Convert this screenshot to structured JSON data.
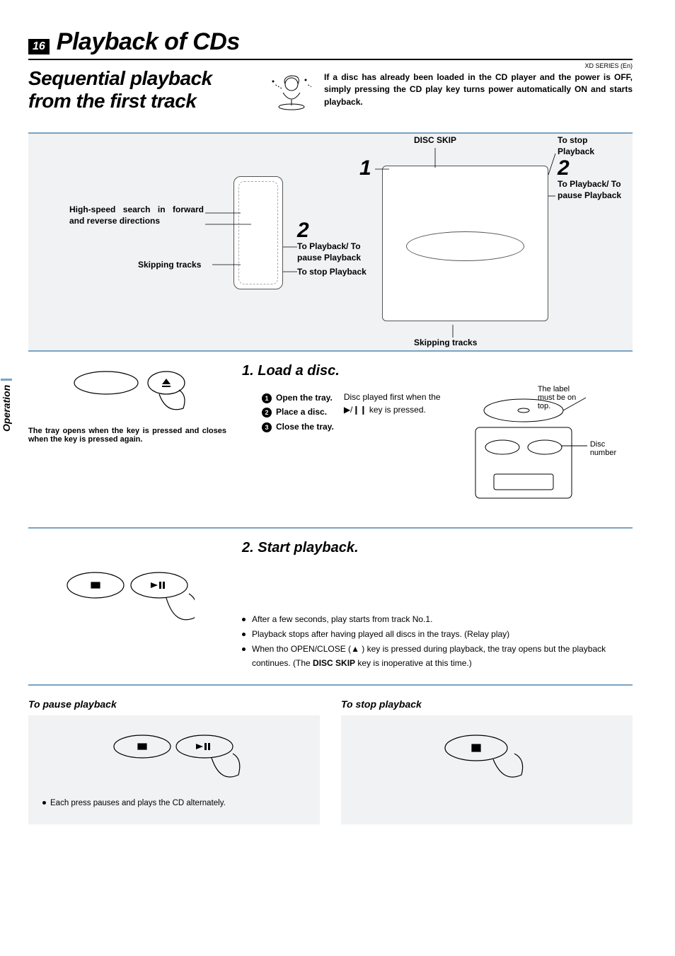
{
  "pageNumber": "16",
  "chapterTitle": "Playback of CDs",
  "sectionTitle": "Sequential playback from the first track",
  "seriesLabel": "XD SERIES (En)",
  "introText": "If a disc has already been loaded in the CD player and the power is OFF, simply pressing the CD play key turns power automatically ON and starts playback.",
  "sideTab": "Operation",
  "diagram": {
    "discSkip": "DISC SKIP",
    "toStop": "To stop Playback",
    "toPlayPause": "To Playback/ To pause Playback",
    "toStopShort": "To stop Playback",
    "highSpeed": "High-speed search in forward and reverse directions",
    "skipping": "Skipping tracks",
    "skippingBottom": "Skipping tracks",
    "step1": "1",
    "step2a": "2",
    "step2b": "2"
  },
  "step1": {
    "heading": "1.  Load a disc.",
    "caption": "The tray opens when the key is pressed and closes when the key is pressed again.",
    "sub1": "Open the tray.",
    "sub2": "Place a disc.",
    "sub3": "Close the tray.",
    "discFirst": "Disc played first when the ▶/❙❙ key is pressed.",
    "labelTop": "The label must be on top.",
    "discNumber": "Disc number"
  },
  "step2": {
    "heading": "2.  Start playback.",
    "b1": "After a few seconds, play starts from track No.1.",
    "b2": "Playback stops after having played all discs in the trays. (Relay play)",
    "b3a": "When tho OPEN/CLOSE (",
    "b3b": " ) key is pressed during playback, the tray opens but the playback continues. (The ",
    "b3c": "DISC SKIP",
    "b3d": " key is inoperative at this time.)"
  },
  "pause": {
    "heading": "To pause playback",
    "note": "Each press pauses and plays the CD alternately."
  },
  "stop": {
    "heading": "To stop playback"
  }
}
